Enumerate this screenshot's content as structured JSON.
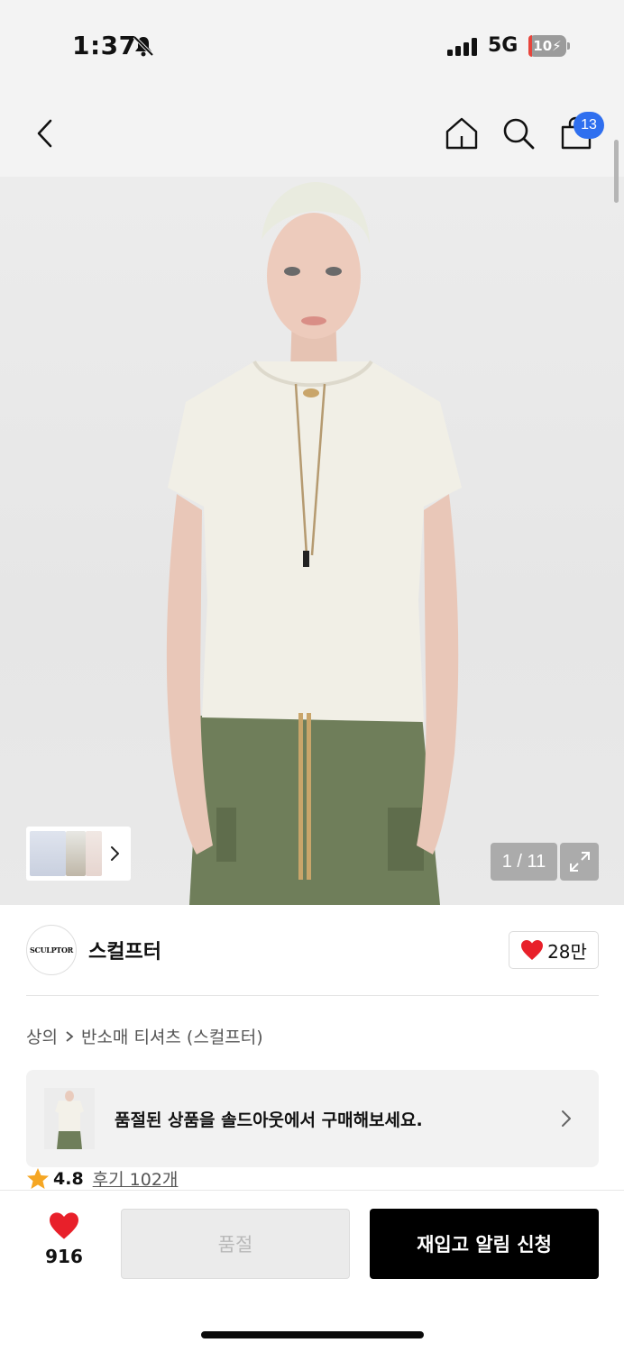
{
  "status_bar": {
    "time": "1:37",
    "network": "5G",
    "battery": "10",
    "battery_level": 0.1
  },
  "nav": {
    "back_icon": "chevron-left-icon",
    "home_icon": "home-icon",
    "search_icon": "search-icon",
    "cart_icon": "shopping-bag-icon",
    "cart_count": "13"
  },
  "gallery": {
    "counter": "1 / 11",
    "expand_icon": "expand-icon"
  },
  "brand": {
    "logo_text": "SCULPTOR",
    "name": "스컬프터",
    "likes": "28만"
  },
  "breadcrumb": {
    "category": "상의",
    "subcategory": "반소매 티셔츠 (스컬프터)"
  },
  "soldout_banner": {
    "text": "품절된 상품을 솔드아웃에서 구매해보세요."
  },
  "rating": {
    "score": "4.8",
    "reviews": "후기 102개"
  },
  "bottom": {
    "wish_count": "916",
    "soldout_label": "품절",
    "restock_label": "재입고 알림 신청"
  },
  "colors": {
    "accent_blue": "#2f6fef",
    "heart_red": "#e8202a",
    "star_orange": "#f5a623",
    "primary_black": "#000000"
  }
}
